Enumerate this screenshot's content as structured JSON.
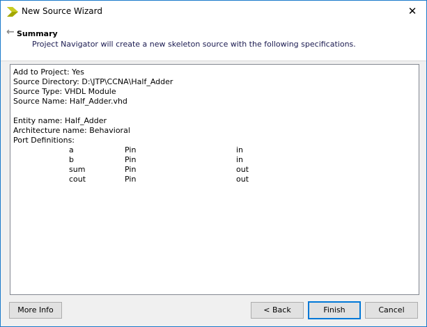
{
  "window": {
    "title": "New Source Wizard",
    "close_icon": "close-icon"
  },
  "header": {
    "title": "Summary",
    "description": "Project Navigator will create a new skeleton source with the following specifications."
  },
  "summary": {
    "lines": [
      "Add to Project: Yes",
      "Source Directory: D:\\JTP\\CCNA\\Half_Adder",
      "Source Type: VHDL Module",
      "Source Name: Half_Adder.vhd",
      "",
      "Entity name: Half_Adder",
      "Architecture name: Behavioral",
      "Port Definitions:"
    ],
    "ports": [
      {
        "name": "a",
        "type": "Pin",
        "dir": "in"
      },
      {
        "name": "b",
        "type": "Pin",
        "dir": "in"
      },
      {
        "name": "sum",
        "type": "Pin",
        "dir": "out"
      },
      {
        "name": "cout",
        "type": "Pin",
        "dir": "out"
      }
    ]
  },
  "buttons": {
    "more_info": "More Info",
    "back": "< Back",
    "finish": "Finish",
    "cancel": "Cancel"
  },
  "colors": {
    "accent": "#0078d7",
    "border": "#1979ca"
  }
}
